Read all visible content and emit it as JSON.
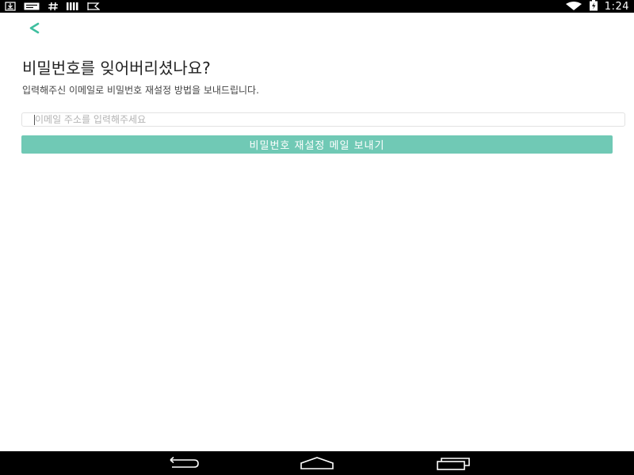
{
  "status_bar": {
    "time": "1:24",
    "left_icons": [
      "download-icon",
      "message-icon",
      "hash-icon",
      "signal-bars-icon",
      "flag-icon"
    ],
    "right_icons": [
      "wifi-icon",
      "battery-charging-icon"
    ]
  },
  "page": {
    "title": "비밀번호를 잊어버리셨나요?",
    "subtitle": "입력해주신 이메일로 비밀번호 재설정 방법을 보내드립니다.",
    "email_placeholder": "이메일 주소를 입력해주세요",
    "email_value": "",
    "submit_label": "비밀번호 재설정 메일 보내기"
  },
  "nav_bar": {
    "buttons": [
      "back-nav-icon",
      "home-nav-icon",
      "recent-apps-icon"
    ]
  },
  "colors": {
    "accent": "#3fbf9f",
    "button": "#70c9b5",
    "status_bar": "#000000"
  }
}
